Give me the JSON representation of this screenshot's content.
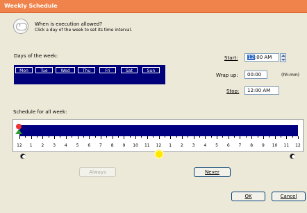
{
  "window": {
    "title": "Weekly Schedule"
  },
  "header": {
    "question": "When is execution allowed?",
    "hint": "Click a day of the week to set its time interval."
  },
  "days": {
    "label": "Days of the week:",
    "items": [
      "Mon",
      "Tue",
      "Wed",
      "Thu",
      "Fri",
      "Sat",
      "Sun"
    ]
  },
  "time": {
    "start_label": "Start:",
    "start_value_selected": "12",
    "start_value_rest": ":00 AM",
    "wrapup_label": "Wrap up:",
    "wrapup_value": "00:00",
    "wrapup_unit": "(hh:mm)",
    "stop_label": "Stop:",
    "stop_value": "12:00 AM"
  },
  "schedule": {
    "label": "Schedule for all week:",
    "hours": [
      "12",
      "1",
      "2",
      "3",
      "4",
      "5",
      "6",
      "7",
      "8",
      "9",
      "10",
      "11",
      "12",
      "1",
      "2",
      "3",
      "4",
      "5",
      "6",
      "7",
      "8",
      "9",
      "10",
      "11",
      "12"
    ]
  },
  "buttons": {
    "always": "Always",
    "never": "Never",
    "ok": "OK",
    "cancel": "Cancel"
  },
  "colors": {
    "titlebar": "#f0834b",
    "timeline_bar": "#000080",
    "days_bar": "#00007a"
  }
}
